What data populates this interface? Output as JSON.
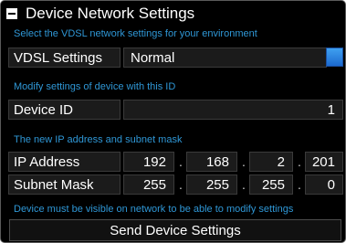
{
  "header": {
    "title": "Device Network Settings",
    "collapse_icon": "minus-box-icon"
  },
  "vdsl": {
    "hint": "Select the VDSL network settings for your environment",
    "label": "VDSL Settings",
    "value": "Normal"
  },
  "device": {
    "hint": "Modify settings of device with this ID",
    "label": "Device ID",
    "value": "1"
  },
  "network": {
    "hint": "The new IP address and subnet mask",
    "ip_label": "IP Address",
    "ip": [
      "192",
      "168",
      "2",
      "201"
    ],
    "mask_label": "Subnet Mask",
    "mask": [
      "255",
      "255",
      "255",
      "0"
    ],
    "separator": "."
  },
  "footer": {
    "note": "Device must be visible on network to be able to modify settings",
    "send_label": "Send Device Settings"
  },
  "colors": {
    "background": "#000000",
    "hint_text": "#2f97d6",
    "field_bg": "#1b1b1b",
    "accent_button": "#2a82e0"
  }
}
